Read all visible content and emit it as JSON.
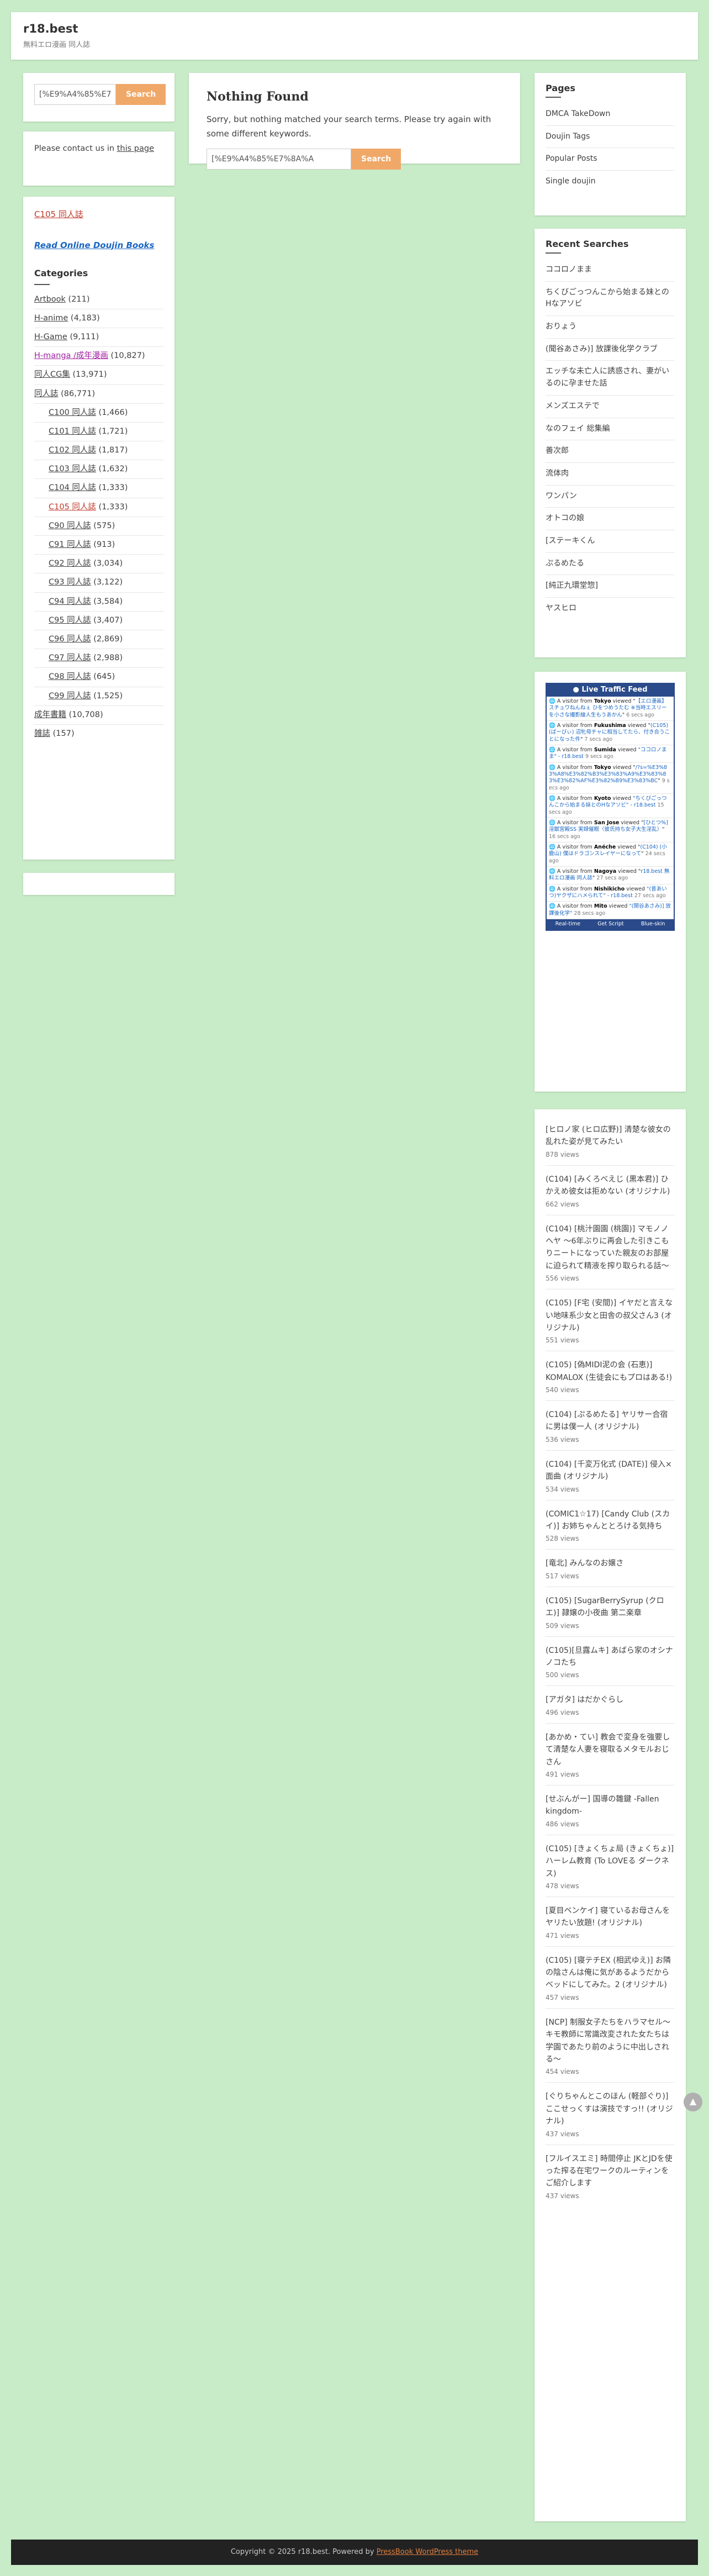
{
  "header": {
    "title": "r18.best",
    "tagline": "無料エロ漫画 同人誌"
  },
  "search": {
    "value": "[%E9%A4%85%E7%8A%A",
    "button": "Search"
  },
  "contact": {
    "prefix": "Please contact us in ",
    "link": "this page"
  },
  "promo": {
    "c105_link": "C105 同人誌",
    "read_online": "Read Online Doujin Books"
  },
  "categories": {
    "title": "Categories",
    "items": [
      {
        "label": "Artbook",
        "count": "(211)"
      },
      {
        "label": "H-anime",
        "count": "(4,183)"
      },
      {
        "label": "H-Game",
        "count": "(9,111)"
      },
      {
        "label": "H-manga /成年漫画",
        "count": "(10,827)"
      },
      {
        "label": "同人CG集",
        "count": "(13,971)"
      },
      {
        "label": "同人誌",
        "count": "(86,771)"
      },
      {
        "label": "C100 同人誌",
        "count": "(1,466)"
      },
      {
        "label": "C101 同人誌",
        "count": "(1,721)"
      },
      {
        "label": "C102 同人誌",
        "count": "(1,817)"
      },
      {
        "label": "C103 同人誌",
        "count": "(1,632)"
      },
      {
        "label": "C104 同人誌",
        "count": "(1,333)"
      },
      {
        "label": "C105 同人誌",
        "count": "(1,333)"
      },
      {
        "label": "C90 同人誌",
        "count": "(575)"
      },
      {
        "label": "C91 同人誌",
        "count": "(913)"
      },
      {
        "label": "C92 同人誌",
        "count": "(3,034)"
      },
      {
        "label": "C93 同人誌",
        "count": "(3,122)"
      },
      {
        "label": "C94 同人誌",
        "count": "(3,584)"
      },
      {
        "label": "C95 同人誌",
        "count": "(3,407)"
      },
      {
        "label": "C96 同人誌",
        "count": "(2,869)"
      },
      {
        "label": "C97 同人誌",
        "count": "(2,988)"
      },
      {
        "label": "C98 同人誌",
        "count": "(645)"
      },
      {
        "label": "C99 同人誌",
        "count": "(1,525)"
      },
      {
        "label": "成年書籍",
        "count": "(10,708)"
      },
      {
        "label": "雑誌",
        "count": "(157)"
      }
    ]
  },
  "main": {
    "title": "Nothing Found",
    "message": "Sorry, but nothing matched your search terms. Please try again with some different keywords."
  },
  "pages": {
    "title": "Pages",
    "items": [
      "DMCA TakeDown",
      "Doujin Tags",
      "Popular Posts",
      "Single doujin"
    ]
  },
  "recent": {
    "title": "Recent Searches",
    "items": [
      "ココロノまま",
      "ちくびごっつんこから始まる妹とのHなアソビ",
      "おりょう",
      "(聞谷あさみ)] 放課後化学クラブ",
      "エッチな未亡人に誘惑され、妻がいるのに孕ませた話",
      "メンズエステで",
      "なのフェイ 総集編",
      "善次郎",
      "流体肉",
      "ワンパン",
      "オトコの娘",
      "[ステーキくん",
      "ぷるめたる",
      "[純正九環堂惣]",
      "ヤスヒロ"
    ]
  },
  "feed": {
    "title": "Live Traffic Feed",
    "items": [
      {
        "city": "Tokyo",
        "page": "【エロ漫画】スチュワねんねぇ ひをつめうたむ ※当時エスリーを小さな撮影線人生もうあかん",
        "ago": "6 secs ago"
      },
      {
        "city": "Fukushima",
        "page": "(C105) (ばーびぃ) 沼牝母チャに相当してたら、付き合うことになった件",
        "ago": "7 secs ago"
      },
      {
        "city": "Sumida",
        "page": "\"ココロノまま\" - r18.best",
        "ago": "9 secs ago"
      },
      {
        "city": "Tokyo",
        "page": "/?s=%E3%83%A8%E3%82%B3%E3%83%A9%E3%83%83%E3%82%AF%E3%82%B9%E3%83%BC",
        "ago": "9 secs ago"
      },
      {
        "city": "Kyoto",
        "page": "\"ちくびごっつんこから始まる妹とのHなアソビ\" - r18.best",
        "ago": "15 secs ago"
      },
      {
        "city": "San Jose",
        "page": "[ひとつ%] 淫獣宮殿SS 実録催眠〈彼氏持ち女子大生淫乱〉",
        "ago": "16 secs ago"
      },
      {
        "city": "Anéche",
        "page": "(C104) (小鹿山) 僕はドラゴンスレイヤーになって",
        "ago": "24 secs ago"
      },
      {
        "city": "Nagoya",
        "page": "r18.best 無料エロ漫画 同人誌",
        "ago": "27 secs ago"
      },
      {
        "city": "Nishikicho",
        "page": "\"(昔あいつ)ヤクザにハメられて\" - r18.best",
        "ago": "27 secs ago"
      },
      {
        "city": "Mito",
        "page": "\"(関谷あさみ)] 放課後化学\"",
        "ago": "28 secs ago"
      }
    ],
    "footer": [
      "Real-time",
      "Get Script",
      "Blue-skin"
    ]
  },
  "popular": {
    "items": [
      {
        "title": "[ヒロノ家 (ヒロ広野)] 清楚な彼女の乱れた姿が見てみたい",
        "views": "878 views"
      },
      {
        "title": "(C104) [みくろべえじ (黒本君)] ひかえめ彼女は拒めない (オリジナル)",
        "views": "662 views"
      },
      {
        "title": "(C104) [桃汁園園 (桃園)] マモノノヘヤ ～6年ぶりに再会した引きこもりニートになっていた親友のお部屋に迫られて精液を搾り取られる話～",
        "views": "556 views"
      },
      {
        "title": "(C105) [F宅 (安間)] イヤだと言えない地味系少女と田舎の叔父さん3 (オリジナル)",
        "views": "551 views"
      },
      {
        "title": "(C105) [偽MIDI泥の会 (石恵)] KOMALOX (生徒会にもプロはある!)",
        "views": "540 views"
      },
      {
        "title": "(C104) [ぷるめたる] ヤリサー合宿に男は僕一人 (オリジナル)",
        "views": "536 views"
      },
      {
        "title": "(C104) [千変万化式 (DATE)] 侵入×面曲 (オリジナル)",
        "views": "534 views"
      },
      {
        "title": "(COMIC1☆17) [Candy Club (スカイ)] お姉ちゃんととろける気持ち",
        "views": "528 views"
      },
      {
        "title": "[竜北] みんなのお嬢さ",
        "views": "517 views"
      },
      {
        "title": "(C105) [SugarBerrySyrup (クロエ)] 隷嬢の小夜曲 第二楽章",
        "views": "509 views"
      },
      {
        "title": "(C105)[旦露ムキ] あばら家のオシナノコたち",
        "views": "500 views"
      },
      {
        "title": "[アガタ] はだかぐらし",
        "views": "496 views"
      },
      {
        "title": "[あかめ・てい] 教会で変身を強要して清楚な人妻を寝取るメタモルおじさん",
        "views": "491 views"
      },
      {
        "title": "[せぶんがー] 国導の雛鍵 -Fallen kingdom-",
        "views": "486 views"
      },
      {
        "title": "(C105) [きょくちょ局 (きょくちょ)] ハーレム教育 (To LOVEる ダークネス)",
        "views": "478 views"
      },
      {
        "title": "[夏目ベンケイ] 寝ているお母さんをヤリたい放題! (オリジナル)",
        "views": "471 views"
      },
      {
        "title": "(C105) [寝テチEX (相武ゆえ)] お隣の陰さんは俺に気があるようだからベッドにしてみた。2 (オリジナル)",
        "views": "457 views"
      },
      {
        "title": "[NCP] 制服女子たちをハラマセル～キモ教師に常識改変された女たちは学園であたり前のように中出しされる～",
        "views": "454 views"
      },
      {
        "title": "[ぐりちゃんとこのほん (軽部ぐり)] ここせっくすは演技ですっ!! (オリジナル)",
        "views": "437 views"
      },
      {
        "title": "[フルイスエミ] 時間停止 JKとJDを使った搾る在宅ワークのルーティンをご紹介します",
        "views": "437 views"
      }
    ]
  },
  "footer": {
    "text": "Copyright © 2025 r18.best. Powered by ",
    "theme": "PressBook WordPress theme"
  },
  "colors": {
    "background": "#c8ebc8",
    "search_button": "#f0a868",
    "link_red": "#c0392b",
    "link_blue": "#1a66c2",
    "feed_blue": "#2a4a8a"
  }
}
